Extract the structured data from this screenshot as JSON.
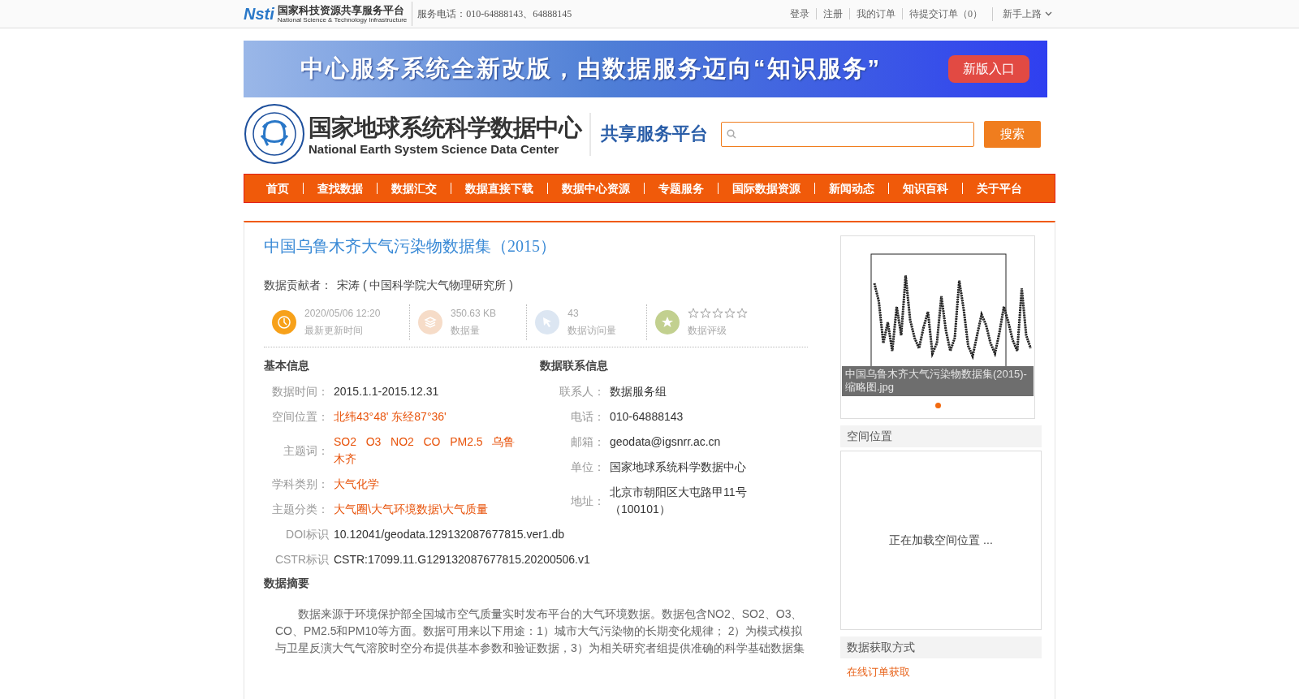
{
  "top_bar": {
    "logo_mark": "Nsti",
    "logo_title": "国家科技资源共享服务平台",
    "logo_subtitle": "National Science & Technology Infrastructure",
    "phone": "服务电话：010-64888143、64888145",
    "links": [
      "登录",
      "注册",
      "我的订单",
      "待提交订单（0）"
    ],
    "guide": "新手上路"
  },
  "banner": {
    "text": "中心服务系统全新改版，由数据服务迈向“知识服务”",
    "button": "新版入口"
  },
  "header": {
    "title": "国家地球系统科学数据中心",
    "subtitle": "National Earth System Science Data Center",
    "platform": "共享服务平台",
    "search_button": "搜索"
  },
  "nav": [
    "首页",
    "查找数据",
    "数据汇交",
    "数据直接下载",
    "数据中心资源",
    "专题服务",
    "国际数据资源",
    "新闻动态",
    "知识百科",
    "关于平台"
  ],
  "dataset": {
    "title": "中国乌鲁木齐大气污染物数据集（2015）",
    "contributor_label": "数据贡献者：",
    "contributor": "宋涛 ( 中国科学院大气物理研究所 )",
    "stats": [
      {
        "kind": "clock",
        "value": "2020/05/06 12:20",
        "label": "最新更新时间"
      },
      {
        "kind": "layers",
        "value": "350.63 KB",
        "label": "数据量"
      },
      {
        "kind": "cursor",
        "value": "43",
        "label": "数据访问量"
      },
      {
        "kind": "rating",
        "stars": 0,
        "label": "数据评级"
      }
    ]
  },
  "basic_info": {
    "heading": "基本信息",
    "rows": [
      {
        "label": "数据时间：",
        "value": "2015.1.1-2015.12.31",
        "highlight": false
      },
      {
        "label": "空间位置：",
        "value": "北纬43°48' 东经87°36'",
        "highlight": true
      },
      {
        "label": "主题词：",
        "value": "SO2   O3   NO2   CO   PM2.5   乌鲁木齐",
        "highlight": true
      },
      {
        "label": "学科类别：",
        "value": "大气化学",
        "highlight": true
      },
      {
        "label": "主题分类：",
        "value": "大气圈\\大气环境数据\\大气质量",
        "highlight": true
      }
    ]
  },
  "contact_info": {
    "heading": "数据联系信息",
    "rows": [
      {
        "label": "联系人：",
        "value": "数据服务组"
      },
      {
        "label": "电话：",
        "value": "010-64888143"
      },
      {
        "label": "邮箱：",
        "value": "geodata@igsnrr.ac.cn"
      },
      {
        "label": "单位：",
        "value": "国家地球系统科学数据中心"
      },
      {
        "label": "地址：",
        "value": "北京市朝阳区大屯路甲11号（100101）"
      }
    ]
  },
  "identifiers": [
    {
      "label": "DOI标识",
      "value": "10.12041/geodata.129132087677815.ver1.db"
    },
    {
      "label": "CSTR标识",
      "value": "CSTR:17099.11.G129132087677815.20200506.v1"
    }
  ],
  "abstract": {
    "heading": "数据摘要",
    "text": "数据来源于环境保护部全国城市空气质量实时发布平台的大气环境数据。数据包含NO2、SO2、O3、CO、PM2.5和PM10等方面。数据可用来以下用途：1）城市大气污染物的长期变化规律； 2）为模式模拟与卫星反演大气气溶胶时空分布提供基本参数和验证数据，3）为相关研究者组提供准确的科学基础数据集"
  },
  "sidebar": {
    "thumbnail": {
      "kind": "picture",
      "caption": "中国乌鲁木齐大气污染物数据集(2015)-缩略图.jpg",
      "dots": [
        {
          "selected": true
        }
      ]
    },
    "location": {
      "heading": "空间位置",
      "loading": "正在加载空间位置 ..."
    },
    "access": {
      "heading": "数据获取方式",
      "link": "在线订单获取"
    }
  }
}
